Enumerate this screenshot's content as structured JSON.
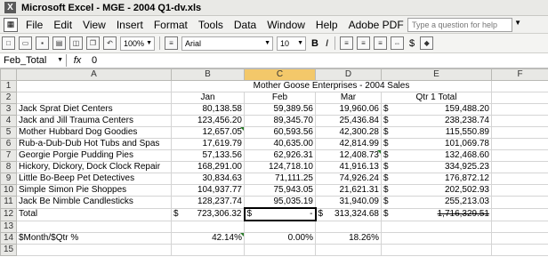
{
  "window": {
    "title": "Microsoft Excel - MGE - 2004 Q1-dv.xls"
  },
  "menu": {
    "items": [
      "File",
      "Edit",
      "View",
      "Insert",
      "Format",
      "Tools",
      "Data",
      "Window",
      "Help",
      "Adobe PDF"
    ],
    "help_placeholder": "Type a question for help"
  },
  "toolbar": {
    "zoom": "100%",
    "font": "Arial",
    "size": "10",
    "bold": "B",
    "italic": "I",
    "currency": "$"
  },
  "formula_bar": {
    "name_box": "Feb_Total",
    "fx": "fx",
    "content": "0"
  },
  "columns": [
    "A",
    "B",
    "C",
    "D",
    "E",
    "F"
  ],
  "rows": [
    {
      "n": "1",
      "a": "",
      "b": "Mother Goose Enterprises - 2004 Sales",
      "c": "",
      "d": "",
      "e": "",
      "f": ""
    },
    {
      "n": "2",
      "a": "",
      "b": "Jan",
      "c": "Feb",
      "d": "Mar",
      "e": "Qtr 1 Total",
      "f": ""
    },
    {
      "n": "3",
      "a": "Jack Sprat Diet Centers",
      "b": "80,138.58",
      "c": "59,389.56",
      "d": "19,960.06",
      "e": "159,488.20",
      "f": ""
    },
    {
      "n": "4",
      "a": "Jack and Jill Trauma Centers",
      "b": "123,456.20",
      "c": "89,345.70",
      "d": "25,436.84",
      "e": "238,238.74",
      "f": ""
    },
    {
      "n": "5",
      "a": "Mother Hubbard Dog Goodies",
      "b": "12,657.05",
      "c": "60,593.56",
      "d": "42,300.28",
      "e": "115,550.89",
      "f": ""
    },
    {
      "n": "6",
      "a": "Rub-a-Dub-Dub Hot Tubs and Spas",
      "b": "17,619.79",
      "c": "40,635.00",
      "d": "42,814.99",
      "e": "101,069.78",
      "f": ""
    },
    {
      "n": "7",
      "a": "Georgie Porgie Pudding Pies",
      "b": "57,133.56",
      "c": "62,926.31",
      "d": "12,408.73",
      "e": "132,468.60",
      "f": ""
    },
    {
      "n": "8",
      "a": "Hickory, Dickory, Dock Clock Repair",
      "b": "168,291.00",
      "c": "124,718.10",
      "d": "41,916.13",
      "e": "334,925.23",
      "f": ""
    },
    {
      "n": "9",
      "a": "Little Bo-Beep Pet Detectives",
      "b": "30,834.63",
      "c": "71,111.25",
      "d": "74,926.24",
      "e": "176,872.12",
      "f": ""
    },
    {
      "n": "10",
      "a": "Simple Simon Pie Shoppes",
      "b": "104,937.77",
      "c": "75,943.05",
      "d": "21,621.31",
      "e": "202,502.93",
      "f": ""
    },
    {
      "n": "11",
      "a": "Jack Be Nimble Candlesticks",
      "b": "128,237.74",
      "c": "95,035.19",
      "d": "31,940.09",
      "e": "255,213.03",
      "f": ""
    },
    {
      "n": "12",
      "a": "Total",
      "b": "723,306.32",
      "c": "-",
      "d": "313,324.68",
      "e": "1,716,329.51",
      "f": ""
    },
    {
      "n": "13",
      "a": "",
      "b": "",
      "c": "",
      "d": "",
      "e": "",
      "f": ""
    },
    {
      "n": "14",
      "a": "$Month/$Qtr %",
      "b": "42.14%",
      "c": "0.00%",
      "d": "18.26%",
      "e": "",
      "f": ""
    },
    {
      "n": "15",
      "a": "",
      "b": "",
      "c": "",
      "d": "",
      "e": "",
      "f": ""
    }
  ],
  "currency_symbol": "$"
}
